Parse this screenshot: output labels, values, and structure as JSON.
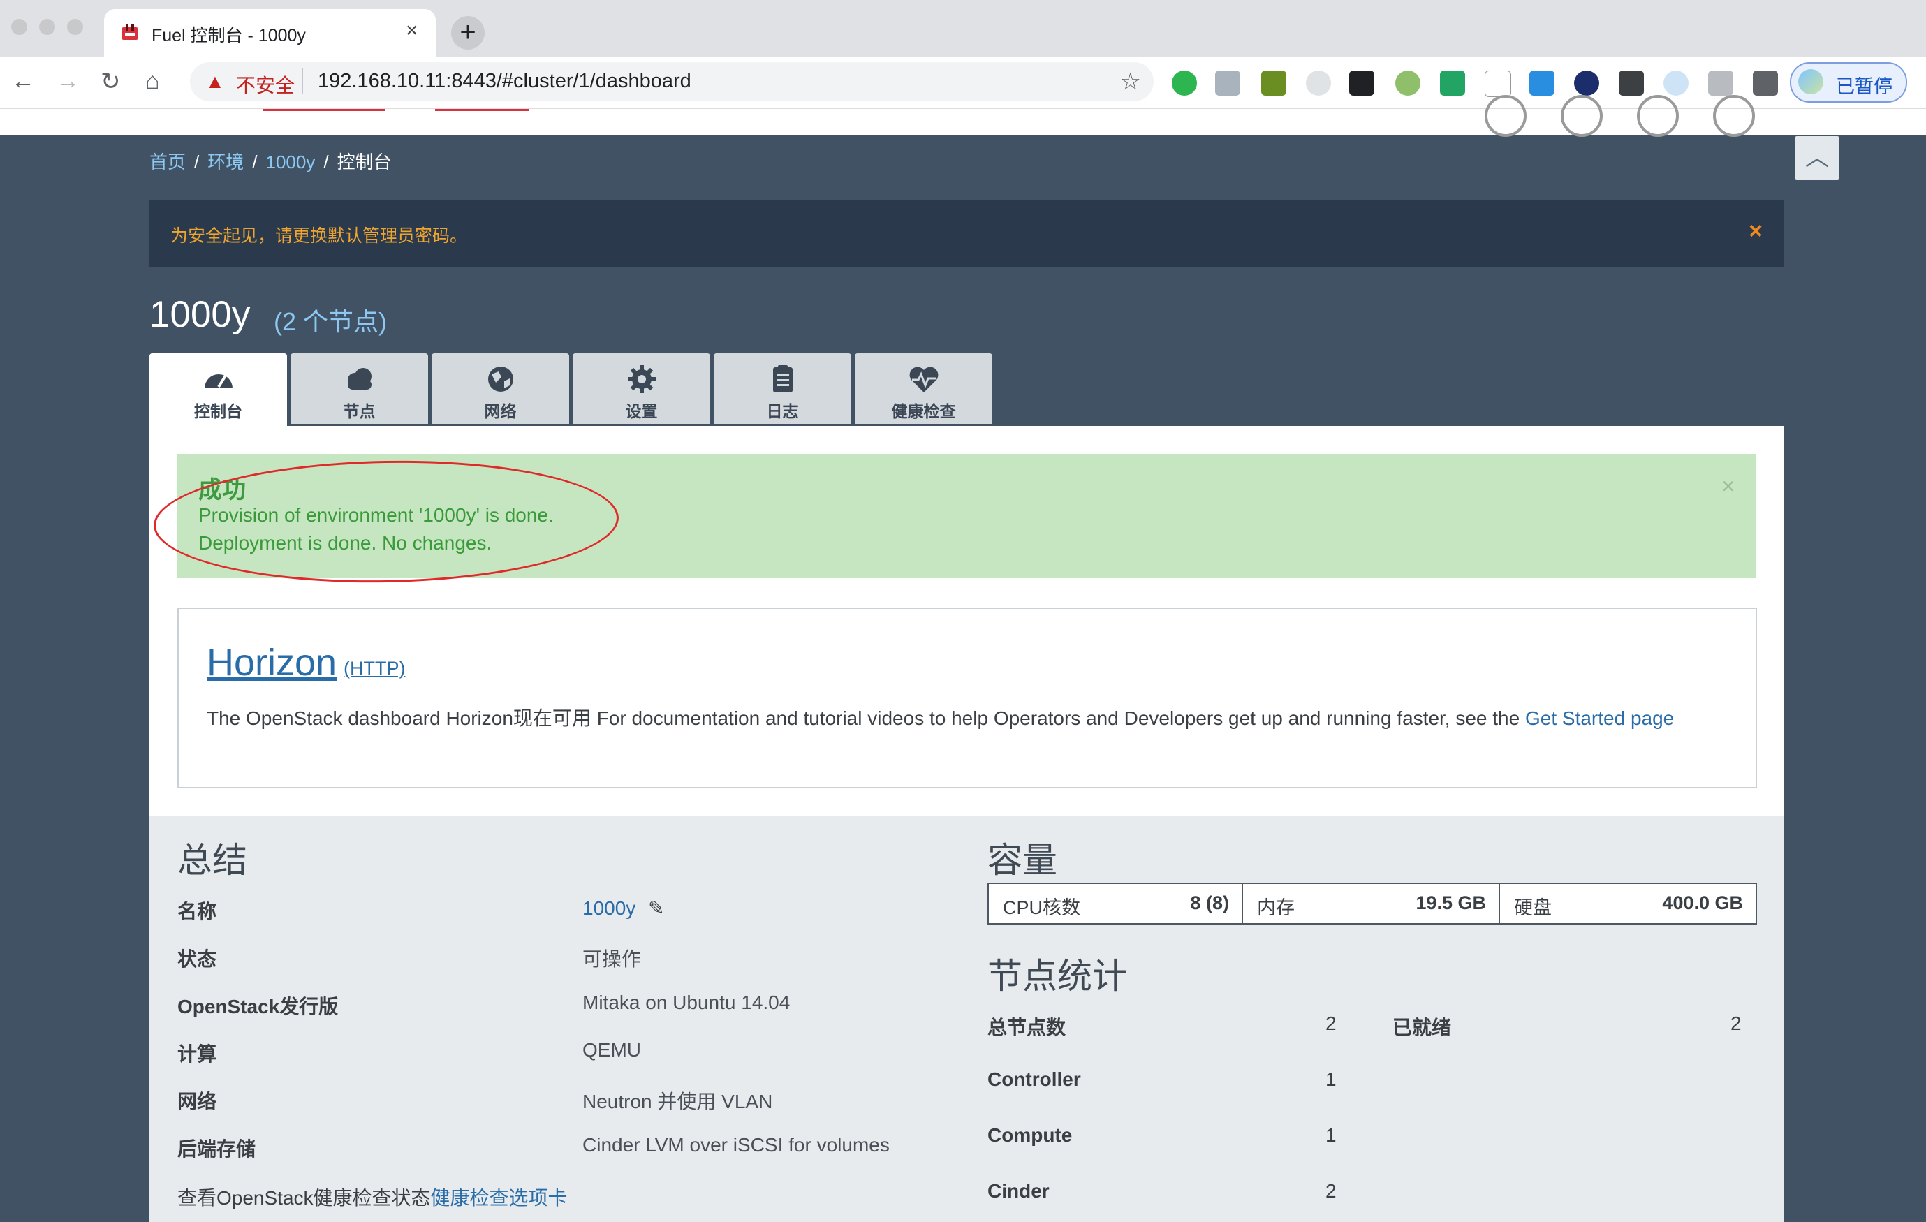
{
  "browser": {
    "tab_title": "Fuel 控制台 - 1000y",
    "new_tab": "+",
    "security_label": "不安全",
    "url": "192.168.10.11:8443/#cluster/1/dashboard",
    "profile_label": "已暂停"
  },
  "breadcrumb": {
    "home": "首页",
    "envs": "环境",
    "cluster": "1000y",
    "current": "控制台"
  },
  "alert": {
    "text": "为安全起见，请更换默认管理员密码。",
    "close": "×"
  },
  "cluster": {
    "name": "1000y",
    "node_count": "(2 个节点)"
  },
  "tabs": [
    {
      "label": "控制台",
      "icon": "dashboard-icon",
      "active": true
    },
    {
      "label": "节点",
      "icon": "cloud-icon"
    },
    {
      "label": "网络",
      "icon": "globe-icon"
    },
    {
      "label": "设置",
      "icon": "gear-icon"
    },
    {
      "label": "日志",
      "icon": "clipboard-icon"
    },
    {
      "label": "健康检查",
      "icon": "heart-pulse-icon"
    }
  ],
  "success": {
    "heading": "成功",
    "line1": "Provision of environment '1000y' is done.",
    "line2": "Deployment is done. No changes.",
    "close": "×"
  },
  "horizon": {
    "title": "Horizon",
    "protocol": "(HTTP)",
    "desc": "The OpenStack dashboard Horizon现在可用 For documentation and tutorial videos to help Operators and Developers get up and running faster, see the ",
    "link": "Get Started page"
  },
  "summary": {
    "title": "总结",
    "rows": [
      {
        "label": "名称",
        "value": "1000y"
      },
      {
        "label": "状态",
        "value": "可操作"
      },
      {
        "label": "OpenStack发行版",
        "value": "Mitaka on Ubuntu 14.04"
      },
      {
        "label": "计算",
        "value": "QEMU"
      },
      {
        "label": "网络",
        "value": "Neutron 并使用 VLAN"
      },
      {
        "label": "后端存储",
        "value": "Cinder LVM over iSCSI for volumes"
      }
    ],
    "health_text": "查看OpenStack健康检查状态",
    "health_link": "健康检查选项卡"
  },
  "capacity": {
    "title": "容量",
    "cpu_label": "CPU核数",
    "cpu_value": "8 (8)",
    "mem_label": "内存",
    "mem_value": "19.5 GB",
    "disk_label": "硬盘",
    "disk_value": "400.0 GB"
  },
  "node_stats": {
    "title": "节点统计",
    "total_label": "总节点数",
    "total_value": "2",
    "ready_label": "已就绪",
    "ready_value": "2",
    "controller_label": "Controller",
    "controller_value": "1",
    "compute_label": "Compute",
    "compute_value": "1",
    "cinder_label": "Cinder",
    "cinder_value": "2"
  }
}
